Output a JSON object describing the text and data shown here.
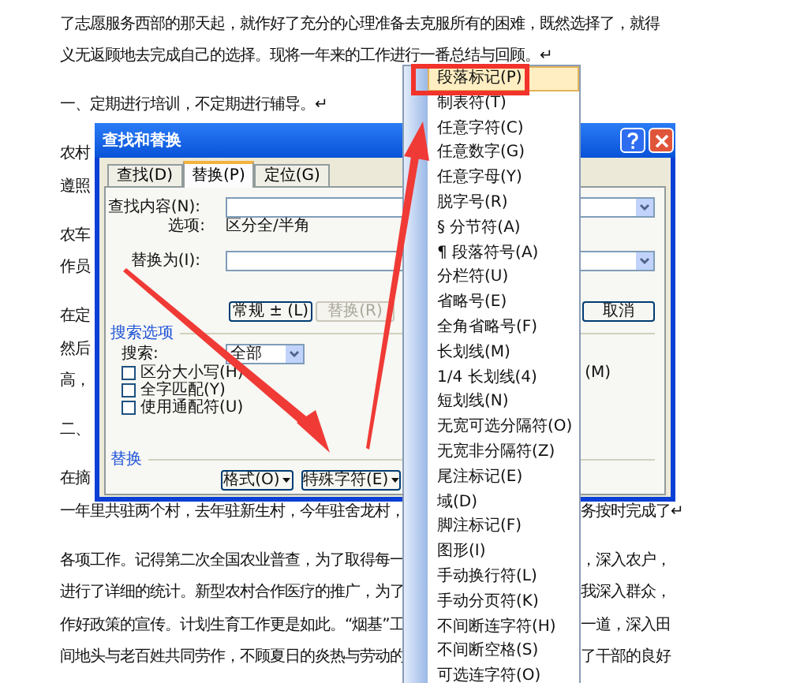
{
  "document": {
    "paragraphs": [
      {
        "lines": [
          {
            "text": "了志愿服务西部的那天起，就作好了充分的心理准备去克服所有的困难，既然选择了，就得"
          },
          {
            "text": "义无返顾地去完成自己的选择。现将一年来的工作进行一番总结与回顾。↵"
          }
        ]
      },
      {
        "lines": [
          {
            "text": "一、定期进行培训，不定期进行辅导。↵"
          }
        ]
      },
      {
        "lines": [
          {
            "text": "农村"
          },
          {
            "text": "遵照"
          }
        ]
      },
      {
        "lines": [
          {
            "text": "农车"
          },
          {
            "text": "作员"
          }
        ]
      },
      {
        "lines": [
          {
            "text": "在定"
          },
          {
            "text": "然后"
          },
          {
            "text": "高，"
          }
        ]
      },
      {
        "lines": [
          {
            "text": "二、"
          }
        ]
      },
      {
        "lines": [
          {
            "text": "在摘"
          },
          {
            "text": "一年里共驻两个村，去年驻新生村，今年驻舍龙村，",
            "right": "务按时完成了↵"
          }
        ]
      },
      {
        "lines": [
          {
            "text": "各项工作。记得第二次全国农业普查，为了取得每一",
            "right": "，深入农户，"
          },
          {
            "text": "进行了详细的统计。新型农村合作医疗的推广，为了",
            "right": "我深入群众，"
          },
          {
            "text": "作好政策的宣传。计划生育工作更是如此。“烟基”工",
            "right": "一道，深入田"
          },
          {
            "text": "间地头与老百姓共同劳作，不顾夏日的炎热与劳动的",
            "right": "了干部的良好"
          }
        ]
      }
    ]
  },
  "dialog": {
    "title": "查找和替换",
    "tabs": [
      {
        "label": "查找(D)",
        "selected": false
      },
      {
        "label": "替换(P)",
        "selected": true
      },
      {
        "label": "定位(G)",
        "selected": false
      }
    ],
    "find_label": "查找内容(N):",
    "options_label": "选项:",
    "options_value": "区分全/半角",
    "replace_label": "替换为(I):",
    "buttons": [
      {
        "label": "常规 ± (L)",
        "disabled": false
      },
      {
        "label": "替换(R)",
        "disabled": true
      },
      {
        "label": "取消",
        "disabled": false
      }
    ],
    "search_options_heading": "搜索选项",
    "search_label": "搜索:",
    "search_value": "全部",
    "checkboxes": [
      {
        "label": "区分大小写(H)",
        "checked": false
      },
      {
        "label": "全字匹配(Y)",
        "checked": false
      },
      {
        "label": "使用通配符(U)",
        "checked": false
      }
    ],
    "right_fragment": "(M)",
    "replace_heading": "替换",
    "bottom_buttons": [
      {
        "label": "格式(O)"
      },
      {
        "label": "特殊字符(E)"
      }
    ]
  },
  "menu": {
    "items": [
      {
        "label": "段落标记(P)",
        "selected": true
      },
      {
        "label": "制表符(T)",
        "selected": false
      },
      {
        "label": "任意字符(C)",
        "selected": false
      },
      {
        "label": "任意数字(G)",
        "selected": false
      },
      {
        "label": "任意字母(Y)",
        "selected": false
      },
      {
        "label": "脱字号(R)",
        "selected": false
      },
      {
        "label": "§ 分节符(A)",
        "selected": false
      },
      {
        "label": "¶ 段落符号(A)",
        "selected": false
      },
      {
        "label": "分栏符(U)",
        "selected": false
      },
      {
        "label": "省略号(E)",
        "selected": false
      },
      {
        "label": "全角省略号(F)",
        "selected": false
      },
      {
        "label": "长划线(M)",
        "selected": false
      },
      {
        "label": "1/4 长划线(4)",
        "selected": false
      },
      {
        "label": "短划线(N)",
        "selected": false
      },
      {
        "label": "无宽可选分隔符(O)",
        "selected": false
      },
      {
        "label": "无宽非分隔符(Z)",
        "selected": false
      },
      {
        "label": "尾注标记(E)",
        "selected": false
      },
      {
        "label": "域(D)",
        "selected": false
      },
      {
        "label": "脚注标记(F)",
        "selected": false
      },
      {
        "label": "图形(I)",
        "selected": false
      },
      {
        "label": "手动换行符(L)",
        "selected": false
      },
      {
        "label": "手动分页符(K)",
        "selected": false
      },
      {
        "label": "不间断连字符(H)",
        "selected": false
      },
      {
        "label": "不间断空格(S)",
        "selected": false
      },
      {
        "label": "可选连字符(O)",
        "selected": false
      }
    ]
  }
}
